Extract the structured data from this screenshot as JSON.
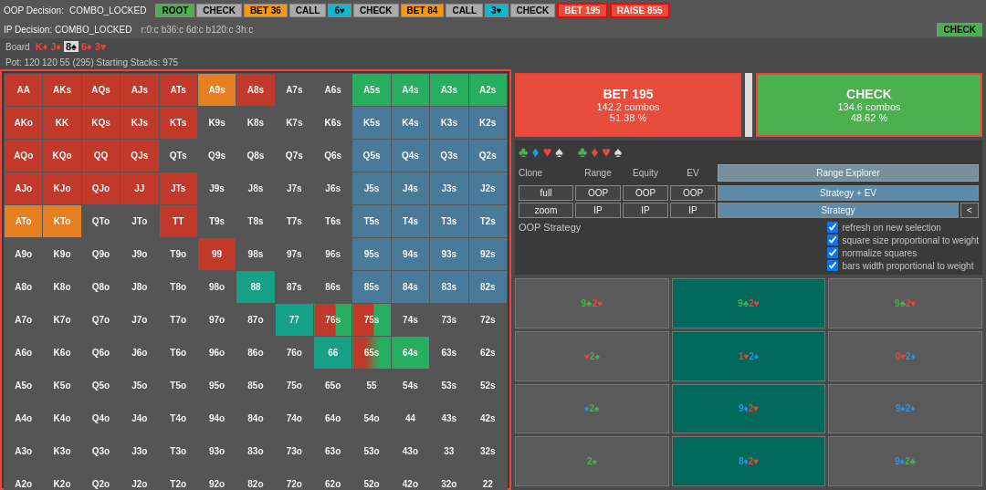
{
  "topBar": {
    "oop_decision_label": "OOP Decision:",
    "combo_locked": "COMBO_LOCKED",
    "buttons": [
      {
        "label": "ROOT",
        "style": "btn-green"
      },
      {
        "label": "CHECK",
        "style": "btn-gray"
      },
      {
        "label": "BET 36",
        "style": "btn-orange"
      },
      {
        "label": "CALL",
        "style": "btn-gray"
      },
      {
        "label": "6♥",
        "style": "btn-cyan"
      },
      {
        "label": "CHECK",
        "style": "btn-gray"
      },
      {
        "label": "BET 84",
        "style": "btn-orange"
      },
      {
        "label": "CALL",
        "style": "btn-gray"
      },
      {
        "label": "3♥",
        "style": "btn-cyan"
      },
      {
        "label": "CHECK",
        "style": "btn-gray"
      },
      {
        "label": "BET 195",
        "style": "btn-active"
      },
      {
        "label": "RAISE 855",
        "style": "btn-active"
      }
    ],
    "check_btn": "CHECK"
  },
  "secondBar": {
    "ip_decision": "IP Decision: COMBO_LOCKED",
    "history": "r:0:c b36:c 6d:c b120:c 3h:c"
  },
  "board": {
    "label": "Board",
    "cards": [
      "K♦",
      "J♦",
      "8♠",
      "6♦",
      "3♥"
    ]
  },
  "pot": {
    "text": "Pot: 120 120 55 (295) Starting Stacks: 975"
  },
  "matrix": {
    "headers": [
      "AA",
      "AKs",
      "AQs",
      "AJs",
      "ATs",
      "A9s",
      "A8s",
      "A7s",
      "A6s",
      "A5s",
      "A4s",
      "A3s",
      "A2s"
    ],
    "rows": [
      [
        "AA",
        "AKs",
        "AQs",
        "AJs",
        "ATs",
        "A9s",
        "A8s",
        "A7s",
        "A6s",
        "A5s",
        "A4s",
        "A3s",
        "A2s"
      ],
      [
        "AKo",
        "KK",
        "KQs",
        "KJs",
        "KTs",
        "K9s",
        "K8s",
        "K7s",
        "K6s",
        "K5s",
        "K4s",
        "K3s",
        "K2s"
      ],
      [
        "AQo",
        "KQo",
        "QQ",
        "QJs",
        "QTs",
        "Q9s",
        "Q8s",
        "Q7s",
        "Q6s",
        "Q5s",
        "Q4s",
        "Q3s",
        "Q2s"
      ],
      [
        "AJo",
        "KJo",
        "QJo",
        "JJ",
        "JTs",
        "J9s",
        "J8s",
        "J7s",
        "J6s",
        "J5s",
        "J4s",
        "J3s",
        "J2s"
      ],
      [
        "ATo",
        "KTo",
        "QTo",
        "JTo",
        "TT",
        "T9s",
        "T8s",
        "T7s",
        "T6s",
        "T5s",
        "T4s",
        "T3s",
        "T2s"
      ],
      [
        "A9o",
        "K9o",
        "Q9o",
        "J9o",
        "T9o",
        "99",
        "98s",
        "97s",
        "96s",
        "95s",
        "94s",
        "93s",
        "92s"
      ],
      [
        "A8o",
        "K8o",
        "Q8o",
        "J8o",
        "T8o",
        "98o",
        "88",
        "87s",
        "86s",
        "85s",
        "84s",
        "83s",
        "82s"
      ],
      [
        "A7o",
        "K7o",
        "Q7o",
        "J7o",
        "T7o",
        "97o",
        "87o",
        "77",
        "76s",
        "75s",
        "74s",
        "73s",
        "72s"
      ],
      [
        "A6o",
        "K6o",
        "Q6o",
        "J6o",
        "T6o",
        "96o",
        "86o",
        "76o",
        "66",
        "65s",
        "64s",
        "63s",
        "62s"
      ],
      [
        "A5o",
        "K5o",
        "Q5o",
        "J5o",
        "T5o",
        "95o",
        "85o",
        "75o",
        "65o",
        "55",
        "54s",
        "53s",
        "52s"
      ],
      [
        "A4o",
        "K4o",
        "Q4o",
        "J4o",
        "T4o",
        "94o",
        "84o",
        "74o",
        "64o",
        "54o",
        "44",
        "43s",
        "42s"
      ],
      [
        "A3o",
        "K3o",
        "Q3o",
        "J3o",
        "T3o",
        "93o",
        "83o",
        "73o",
        "63o",
        "53o",
        "43o",
        "33",
        "32s"
      ],
      [
        "A2o",
        "K2o",
        "Q2o",
        "J2o",
        "T2o",
        "92o",
        "82o",
        "72o",
        "62o",
        "52o",
        "42o",
        "32o",
        "22"
      ]
    ],
    "highlights": {
      "red": [
        "AA",
        "AKs",
        "AQs",
        "AJs",
        "ATs",
        "AKo",
        "KK",
        "AQo",
        "KQo",
        "QQ",
        "AJo",
        "KJo",
        "QJo",
        "JJ",
        "KTs",
        "KJs",
        "KQs"
      ],
      "orange": [
        "A9s",
        "ATo",
        "KTo",
        "QTo",
        "JTo"
      ],
      "teal": [
        "88",
        "77",
        "66"
      ],
      "mixed_red_green": [
        "76s",
        "65s",
        "75s"
      ],
      "green": [
        "A5s",
        "A4s",
        "A3s",
        "A2s"
      ]
    }
  },
  "decision": {
    "bet": {
      "label": "BET 195",
      "combos": "142.2 combos",
      "pct": "51.38 %"
    },
    "check": {
      "label": "CHECK",
      "combos": "134.6 combos",
      "pct": "48.62 %"
    }
  },
  "controls": {
    "suits_row1": [
      "♣",
      "♦",
      "♥",
      "♠"
    ],
    "suits_row2": [
      "♣",
      "♦",
      "♥",
      "♠"
    ],
    "col_headers": [
      "Clone",
      "Range",
      "Equity",
      "EV",
      ""
    ],
    "row_full": [
      "full",
      "OOP",
      "OOP",
      "OOP",
      "Range Explorer"
    ],
    "row_zoom": [
      "zoom",
      "IP",
      "IP",
      "IP",
      "Strategy"
    ],
    "strategy_plus_ev": "Strategy + EV",
    "arrow": "<",
    "oop_strategy": "OOP Strategy",
    "checkboxes": [
      {
        "label": "refresh on new selection",
        "checked": true
      },
      {
        "label": "square size proportional to weight",
        "checked": true
      },
      {
        "label": "normalize squares",
        "checked": true
      },
      {
        "label": "bars width proportional to weight",
        "checked": true
      }
    ]
  },
  "cardGrid": [
    {
      "label": "9♣ 2♥",
      "style": "normal"
    },
    {
      "label": "9♣ 2♥",
      "style": "teal"
    },
    {
      "label": "9♣ 2♥",
      "style": "normal"
    },
    {
      "label": "♥ 2♠",
      "style": "normal"
    },
    {
      "label": "1♥ 2♦",
      "style": "teal"
    },
    {
      "label": "0♥ 2♦",
      "style": "normal"
    },
    {
      "label": "♦ 2♠",
      "style": "normal"
    },
    {
      "label": "9♦ 2♥",
      "style": "teal"
    },
    {
      "label": "9♦ 2♦",
      "style": "normal"
    },
    {
      "label": "2♠",
      "style": "normal"
    },
    {
      "label": "8♦ 2♥",
      "style": "teal"
    },
    {
      "label": "9♦ 2♣",
      "style": "normal"
    }
  ]
}
